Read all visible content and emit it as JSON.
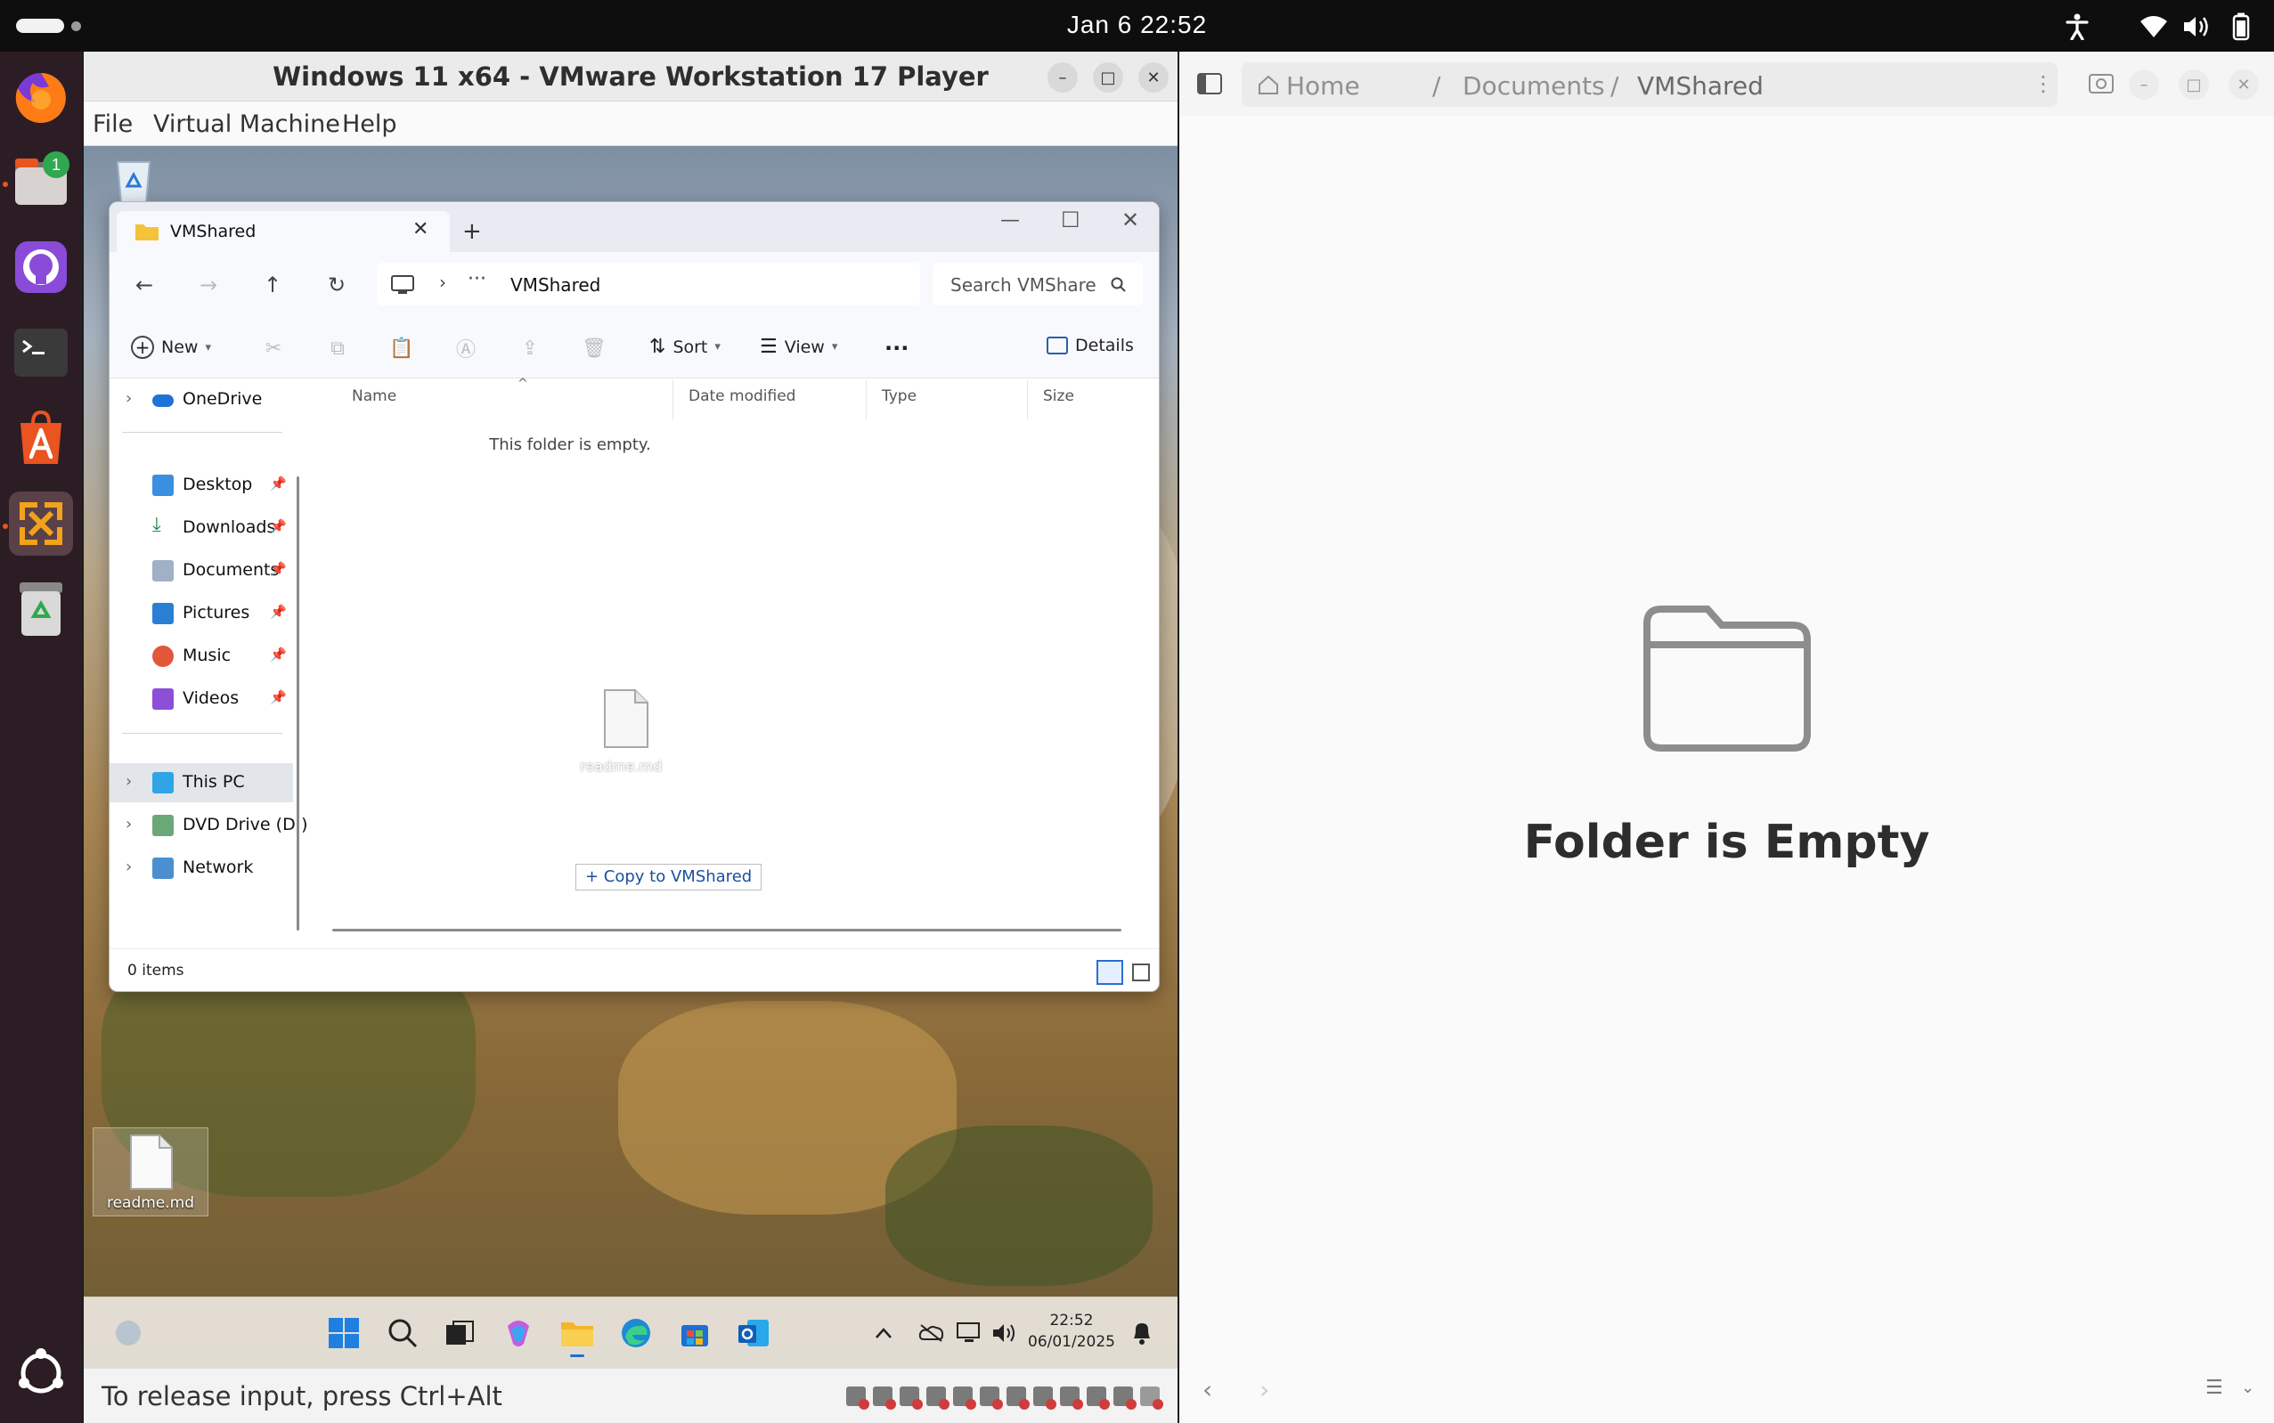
{
  "topbar": {
    "clock": "Jan 6  22:52",
    "icons": [
      "accessibility-icon",
      "wifi-icon",
      "volume-icon",
      "battery-icon"
    ]
  },
  "dock": {
    "items": [
      "firefox",
      "files",
      "github-desktop",
      "terminal",
      "app-center",
      "vmware-player",
      "trash"
    ],
    "files_badge": "1"
  },
  "vmware": {
    "title": "Windows 11 x64 - VMware Workstation 17 Player",
    "menu": [
      "File",
      "Virtual Machine",
      "Help"
    ],
    "status_text": "To release input, press Ctrl+Alt"
  },
  "guest": {
    "desktop_file_label": "readme.md",
    "taskbar": {
      "time": "22:52",
      "date": "06/01/2025"
    },
    "explorer": {
      "tab_label": "VMShared",
      "address_current": "VMShared",
      "search_placeholder": "Search VMShare",
      "commands": {
        "new": "New",
        "sort": "Sort",
        "view": "View",
        "details": "Details"
      },
      "nav_pane": {
        "onedrive": "OneDrive",
        "quick_access": [
          "Desktop",
          "Downloads",
          "Documents",
          "Pictures",
          "Music",
          "Videos"
        ],
        "this_pc": "This PC",
        "dvd": "DVD Drive (D:) C",
        "network": "Network"
      },
      "columns": [
        "Name",
        "Date modified",
        "Type",
        "Size"
      ],
      "empty_message": "This folder is empty.",
      "drag_file_label": "readme.md",
      "drag_tooltip": "+ Copy to VMShared",
      "status": "0 items"
    }
  },
  "files": {
    "breadcrumb": [
      "Home",
      "Documents",
      "VMShared"
    ],
    "empty_text": "Folder is Empty"
  }
}
